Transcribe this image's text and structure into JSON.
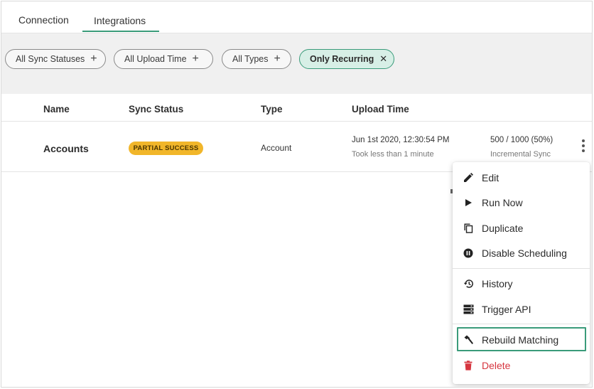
{
  "tabs": [
    {
      "label": "Connection"
    },
    {
      "label": "Integrations",
      "active": true
    }
  ],
  "filters": [
    {
      "label": "All Sync Statuses",
      "icon": "plus-icon"
    },
    {
      "label": "All Upload Time",
      "icon": "plus-icon"
    },
    {
      "label": "All Types",
      "icon": "plus-icon"
    },
    {
      "label": "Only Recurring",
      "icon": "close-icon",
      "active": true
    }
  ],
  "table": {
    "headers": {
      "name": "Name",
      "sync_status": "Sync Status",
      "type": "Type",
      "upload_time": "Upload Time"
    },
    "rows": [
      {
        "name": "Accounts",
        "status": "PARTIAL SUCCESS",
        "type": "Account",
        "upload_time": "Jun 1st 2020, 12:30:54 PM",
        "upload_duration": "Took less than 1 minute",
        "progress": "500 / 1000 (50%)",
        "sync_mode": "Incremental Sync"
      }
    ]
  },
  "menu": {
    "items": [
      {
        "label": "Edit",
        "icon": "pencil-icon"
      },
      {
        "label": "Run Now",
        "icon": "play-icon"
      },
      {
        "label": "Duplicate",
        "icon": "copy-icon"
      },
      {
        "label": "Disable Scheduling",
        "icon": "pause-circle-icon"
      },
      {
        "label": "History",
        "icon": "history-icon"
      },
      {
        "label": "Trigger API",
        "icon": "server-icon"
      },
      {
        "label": "Rebuild Matching",
        "icon": "hammer-icon",
        "highlighted": true
      },
      {
        "label": "Delete",
        "icon": "trash-icon",
        "danger": true
      }
    ]
  },
  "colors": {
    "accent": "#3a9b7a",
    "status_partial": "#f1b62a",
    "danger": "#d6353f"
  }
}
